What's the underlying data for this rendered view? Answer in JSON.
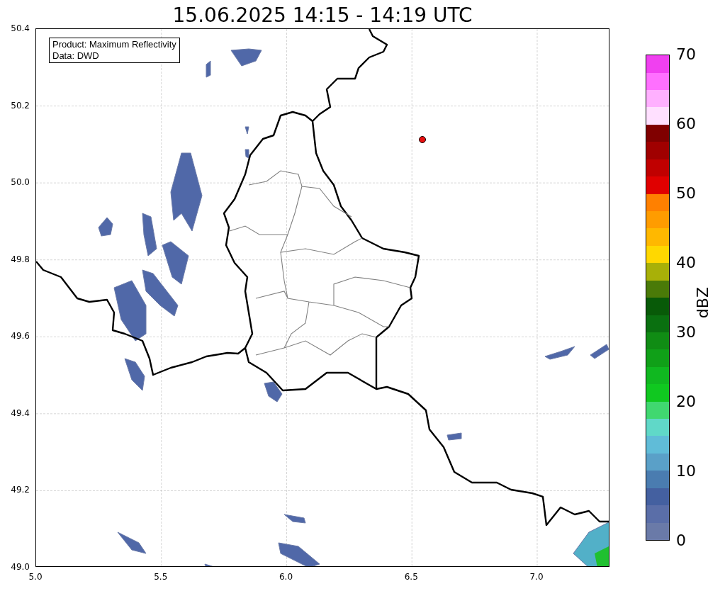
{
  "title": "15.06.2025 14:15 - 14:19 UTC",
  "map": {
    "info_box": [
      "Product: Maximum Reflectivity",
      "Data: DWD"
    ],
    "x_ticks": [
      "5.0",
      "5.5",
      "6.0",
      "6.5",
      "7.0"
    ],
    "y_ticks": [
      "50.4",
      "50.2",
      "50.0",
      "49.8",
      "49.6",
      "49.4",
      "49.2",
      "49.0"
    ]
  },
  "colorbar": {
    "label": "dBZ",
    "ticks": [
      "70",
      "60",
      "50",
      "40",
      "30",
      "20",
      "10",
      "0"
    ],
    "segments": [
      {
        "color": "#6a7aa8"
      },
      {
        "color": "#5a6ea8"
      },
      {
        "color": "#4460a0"
      },
      {
        "color": "#4a7cb0"
      },
      {
        "color": "#5aa0c8"
      },
      {
        "color": "#60bcd8"
      },
      {
        "color": "#60d8c8"
      },
      {
        "color": "#40d870"
      },
      {
        "color": "#10c820"
      },
      {
        "color": "#10b820"
      },
      {
        "color": "#10a018"
      },
      {
        "color": "#108c14"
      },
      {
        "color": "#0a7010"
      },
      {
        "color": "#085a08"
      },
      {
        "color": "#4a7a08"
      },
      {
        "color": "#a8b008"
      },
      {
        "color": "#ffd800"
      },
      {
        "color": "#ffb800"
      },
      {
        "color": "#ff9c00"
      },
      {
        "color": "#ff8000"
      },
      {
        "color": "#e00000"
      },
      {
        "color": "#c00000"
      },
      {
        "color": "#a00000"
      },
      {
        "color": "#800000"
      },
      {
        "color": "#ffe0ff"
      },
      {
        "color": "#ffb0ff"
      },
      {
        "color": "#ff70ff"
      },
      {
        "color": "#f040f0"
      }
    ]
  }
}
